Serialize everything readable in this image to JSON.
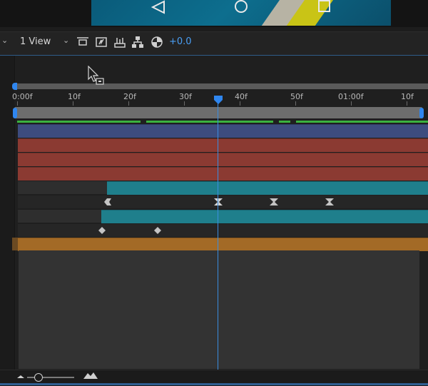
{
  "toolbar": {
    "view_select": "1 View",
    "exposure": "+0.0"
  },
  "ruler": {
    "labels": [
      "0:00f",
      "10f",
      "20f",
      "30f",
      "40f",
      "50f",
      "01:00f",
      "10f"
    ]
  },
  "icons": {
    "nav_back": "triangle-back-icon",
    "nav_home": "circle-home-icon",
    "nav_recents": "square-recents-icon",
    "toolbar": [
      "region-of-interest-icon",
      "snapshot-icon",
      "channel-icon",
      "flowchart-icon",
      "exposure-reset-icon"
    ],
    "footer": [
      "zoom-out-mountain-icon",
      "zoom-in-mountain-icon"
    ]
  },
  "colors": {
    "accent": "#2f86ef",
    "cti": "#3a8de0",
    "green_bar": "#3bb23e",
    "layer_blue": "#3d4c7e",
    "layer_red": "#8b3a32",
    "layer_teal": "#1f7f8c",
    "layer_orange": "#a36a26"
  }
}
